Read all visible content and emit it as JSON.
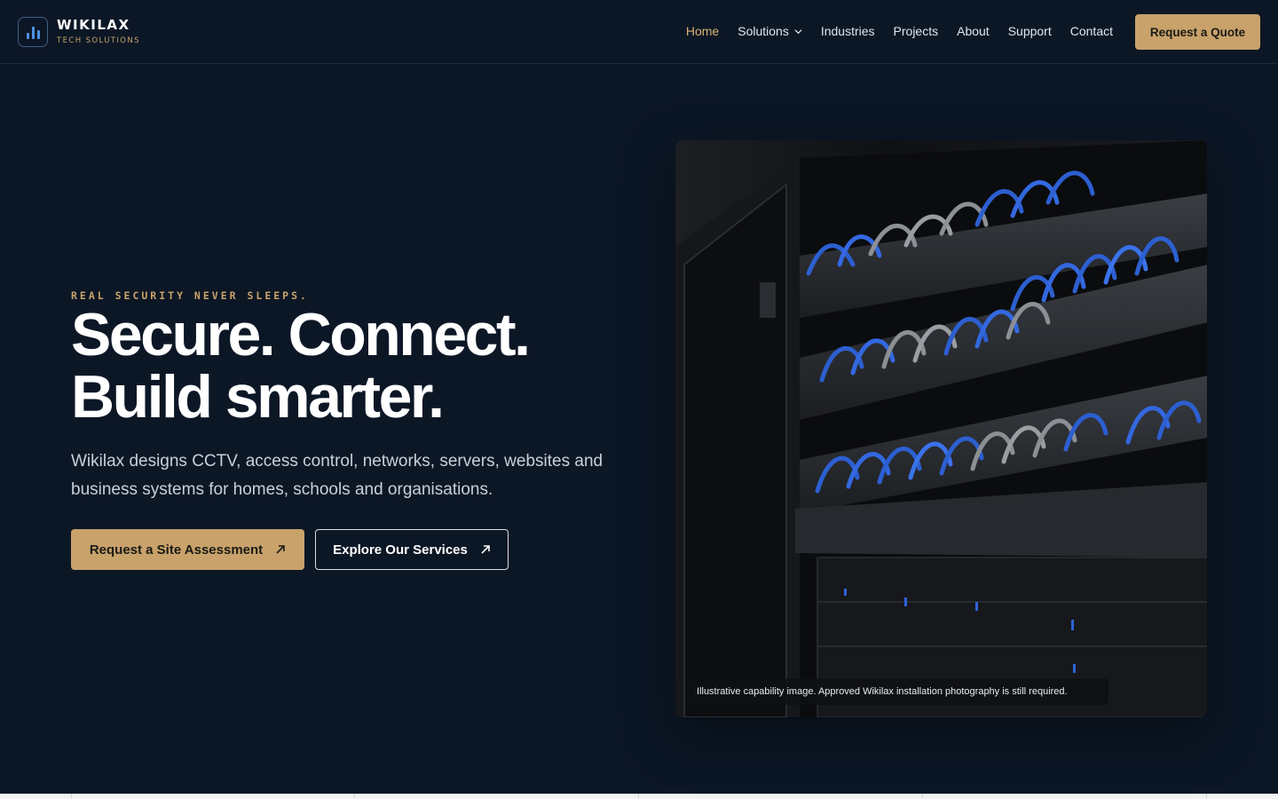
{
  "brand": {
    "name": "WIKILAX",
    "tagline": "TECH SOLUTIONS",
    "accent": "#c8a26a"
  },
  "nav": {
    "items": [
      {
        "label": "Home",
        "active": true
      },
      {
        "label": "Solutions",
        "dropdown": true
      },
      {
        "label": "Industries"
      },
      {
        "label": "Projects"
      },
      {
        "label": "About"
      },
      {
        "label": "Support"
      },
      {
        "label": "Contact"
      }
    ],
    "cta": "Request a Quote"
  },
  "hero": {
    "eyebrow": "REAL SECURITY NEVER SLEEPS.",
    "headline_line1": "Secure. Connect.",
    "headline_line2": "Build smarter.",
    "lead": "Wikilax designs CCTV, access control, networks, servers, websites and business systems for homes, schools and organisations.",
    "primary_button": "Request a Site Assessment",
    "secondary_button": "Explore Our Services",
    "button_icon": "arrow-up-right-icon",
    "image_caption": "Illustrative capability image. Approved Wikilax installation photography is still required."
  }
}
